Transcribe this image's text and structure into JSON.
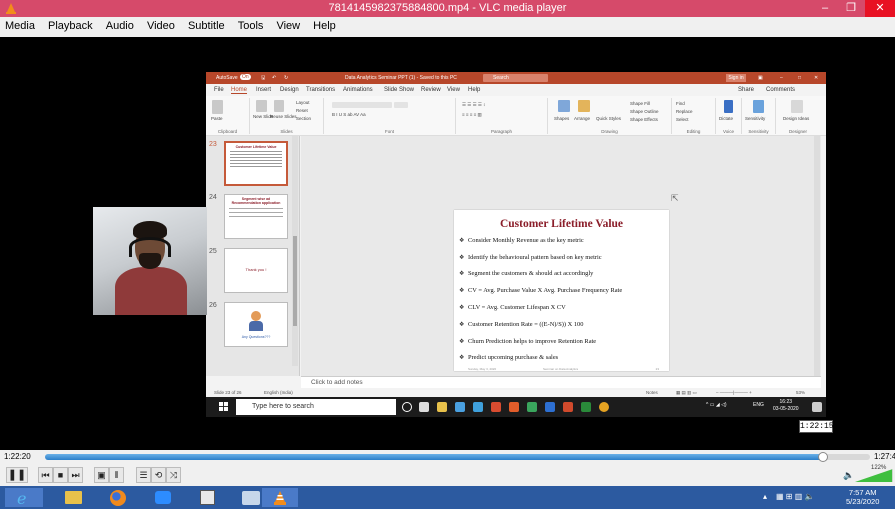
{
  "vlc": {
    "title": "7814145982375884800.mp4 - VLC media player",
    "menu": [
      "Media",
      "Playback",
      "Audio",
      "Video",
      "Subtitle",
      "Tools",
      "View",
      "Help"
    ],
    "time_elapsed": "1:22:20",
    "time_total": "1:27:4",
    "progress_percent": 94.3,
    "volume_label": "122%",
    "overlay_timestamp": "1:22:15"
  },
  "ppt": {
    "autosave": "AutoSave",
    "autosave_state": "On",
    "doc_title": "Data Analytics Seminar PPT (1) - Saved to this PC",
    "search_placeholder": "Search",
    "signin": "Sign in",
    "tabs": [
      "File",
      "Home",
      "Insert",
      "Design",
      "Transitions",
      "Animations",
      "Slide Show",
      "Review",
      "View",
      "Help"
    ],
    "share": "Share",
    "comments": "Comments",
    "ribbon": {
      "paste": "Paste",
      "new_slide": "New Slide",
      "reuse_slides": "Reuse Slides",
      "layout": "Layout",
      "reset": "Reset",
      "section": "Section",
      "shapes": "Shapes",
      "arrange": "Arrange",
      "quick_styles": "Quick Styles",
      "shape_fill": "Shape Fill",
      "shape_outline": "Shape Outline",
      "shape_effects": "Shape Effects",
      "find": "Find",
      "replace": "Replace",
      "select": "Select",
      "dictate": "Dictate",
      "sensitivity": "Sensitivity",
      "design_ideas": "Design Ideas",
      "groups": [
        "Clipboard",
        "Slides",
        "Font",
        "Paragraph",
        "Drawing",
        "Editing",
        "Voice",
        "Sensitivity",
        "Designer"
      ]
    },
    "thumbnails": [
      {
        "num": "23",
        "title": "Customer Lifetime Value"
      },
      {
        "num": "24",
        "title": "Segment wise ad Recommendation application"
      },
      {
        "num": "25",
        "title": "Thank you !"
      },
      {
        "num": "26",
        "title": "Any Questions???"
      }
    ],
    "slide": {
      "title": "Customer Lifetime Value",
      "bullets": [
        "Consider Monthly Revenue as the key metric",
        "Identify the behavioural pattern based on key metric",
        "Segment the customers & should act accordingly",
        "CV = Avg. Purchase Value X  Avg. Purchase Frequency Rate",
        "CLV = Avg. Customer Lifespan X CV",
        "Customer Retention Rate = ((E-N)/S)) X 100",
        "Churn Prediction helps to improve Retention Rate",
        "Predict upcoming purchase & sales"
      ],
      "footer_left": "Sunday, May 3, 2020",
      "footer_center": "Seminar on Data Analytics",
      "footer_right": "23"
    },
    "notes_placeholder": "Click to add notes",
    "status_slide": "Slide 23 of 26",
    "status_lang": "English (India)",
    "status_notes": "Notes",
    "status_zoom": "53%"
  },
  "inner_taskbar": {
    "search_placeholder": "Type here to search",
    "tray_lang": "ENG",
    "time": "16:23",
    "date": "03-05-2020"
  },
  "host_taskbar": {
    "time": "7:57 AM",
    "date": "5/23/2020"
  },
  "colors": {
    "vlc_titlebar": "#d64a6a",
    "ppt_accent": "#b7472a",
    "slide_title": "#8b1e2a",
    "host_taskbar": "#2c5aa0"
  }
}
